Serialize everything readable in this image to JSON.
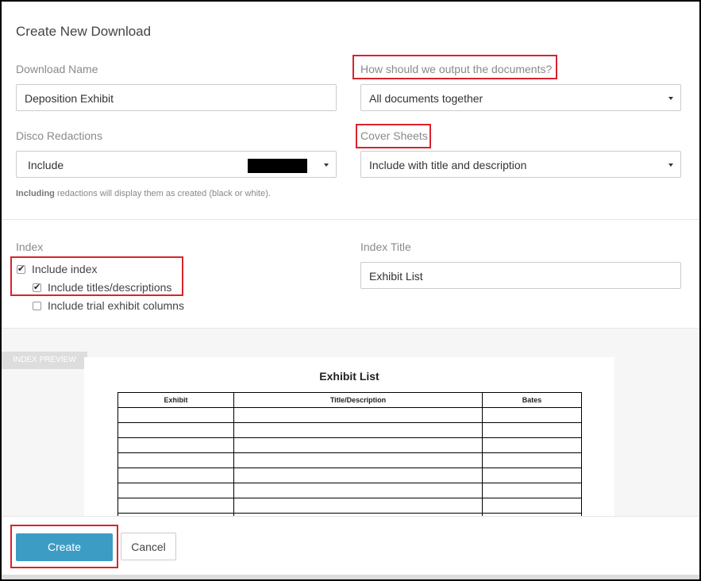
{
  "dialog": {
    "title": "Create New Download"
  },
  "download_name": {
    "label": "Download Name",
    "value": "Deposition Exhibit"
  },
  "output": {
    "label": "How should we output the documents?",
    "selected": "All documents together"
  },
  "redactions": {
    "label": "Disco Redactions",
    "selected": "Include",
    "hint_bold": "Including",
    "hint_rest": " redactions will display them as created (black or white)."
  },
  "cover_sheets": {
    "label": "Cover Sheets",
    "selected": "Include with title and description"
  },
  "index": {
    "label": "Index",
    "include_index": {
      "label": "Include index",
      "checked": true
    },
    "include_titles": {
      "label": "Include titles/descriptions",
      "checked": true
    },
    "include_trial": {
      "label": "Include trial exhibit columns",
      "checked": false
    }
  },
  "index_title": {
    "label": "Index Title",
    "value": "Exhibit List"
  },
  "preview": {
    "tab_label": "INDEX PREVIEW",
    "title": "Exhibit List",
    "columns": [
      "Exhibit",
      "Title/Description",
      "Bates"
    ]
  },
  "footer": {
    "create_label": "Create",
    "cancel_label": "Cancel"
  },
  "colors": {
    "annotation": "#d9232d",
    "primary": "#3c9cc4"
  }
}
